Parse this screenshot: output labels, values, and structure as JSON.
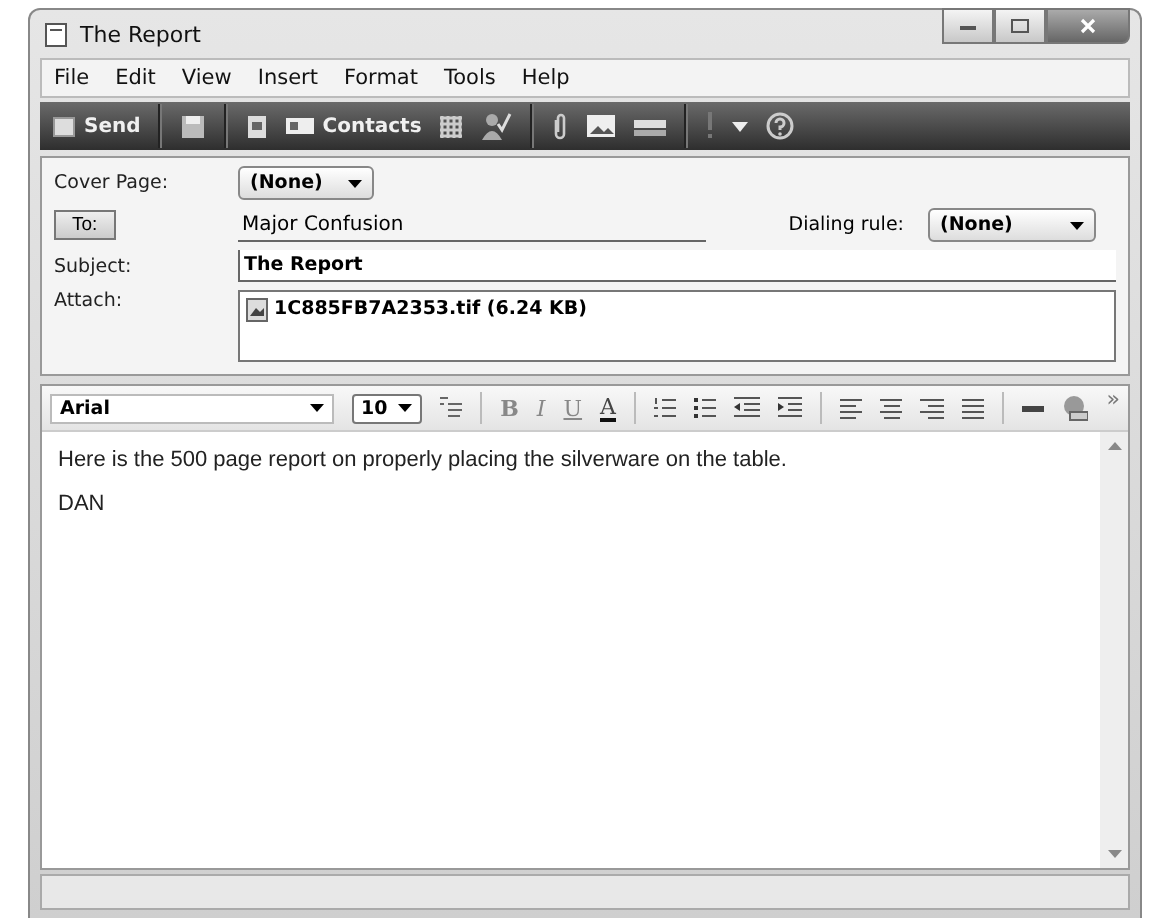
{
  "window": {
    "title": "The Report"
  },
  "menu": [
    "File",
    "Edit",
    "View",
    "Insert",
    "Format",
    "Tools",
    "Help"
  ],
  "toolbar": {
    "send": "Send",
    "contacts": "Contacts"
  },
  "form": {
    "cover_label": "Cover Page:",
    "cover_value": "(None)",
    "to_button": "To:",
    "to_value": "Major Confusion",
    "dialing_label": "Dialing rule:",
    "dialing_value": "(None)",
    "subject_label": "Subject:",
    "subject_value": "The Report",
    "attach_label": "Attach:",
    "attachment": "1C885FB7A2353.tif (6.24 KB)"
  },
  "format_bar": {
    "font": "Arial",
    "size": "10",
    "bold": "B",
    "italic": "I",
    "underline": "U",
    "font_color": "A",
    "more": "»"
  },
  "body": [
    "Here is the 500 page report on properly placing the silverware on the table.",
    "DAN"
  ]
}
